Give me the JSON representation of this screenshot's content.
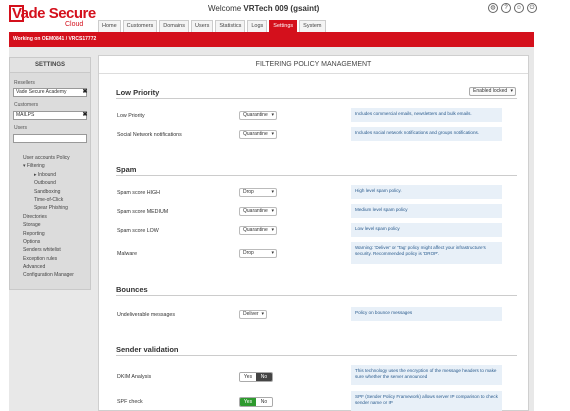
{
  "brand": {
    "name": "Vade Secure",
    "sub": "Cloud"
  },
  "header": {
    "welcome_prefix": "Welcome ",
    "welcome_user": "VRTech 009 (gsaint)",
    "tabs": [
      {
        "label": "Home"
      },
      {
        "label": "Customers"
      },
      {
        "label": "Domains"
      },
      {
        "label": "Users"
      },
      {
        "label": "Statistics"
      },
      {
        "label": "Logs"
      },
      {
        "label": "Settings",
        "active": true
      },
      {
        "label": "System"
      }
    ]
  },
  "context_bar": "Working on OEM0841 / VRCS17772",
  "sidebar": {
    "title": "SETTINGS",
    "reseller_label": "Resellers",
    "reseller_value": "Vade Secure Academy",
    "customer_label": "Customers",
    "customer_value": "MAILPS",
    "users_label": "Users",
    "users_value": "",
    "menu": [
      {
        "label": "User accounts Policy",
        "level": 1
      },
      {
        "label": "▾ Filtering",
        "level": 1
      },
      {
        "label": "▸ Inbound",
        "level": 2
      },
      {
        "label": "Outbound",
        "level": 2
      },
      {
        "label": "Sandboxing",
        "level": 2
      },
      {
        "label": "Time-of-Click",
        "level": 2
      },
      {
        "label": "Spear Phishing",
        "level": 2
      },
      {
        "label": "Directories",
        "level": 1
      },
      {
        "label": "Storage",
        "level": 1
      },
      {
        "label": "Reporting",
        "level": 1
      },
      {
        "label": "Options",
        "level": 1
      },
      {
        "label": "Senders whitelist",
        "level": 1
      },
      {
        "label": "Exception rules",
        "level": 1
      },
      {
        "label": "Advanced",
        "level": 1
      },
      {
        "label": "Configuration Manager",
        "level": 1
      }
    ]
  },
  "main": {
    "title": "FILTERING POLICY MANAGEMENT",
    "mode_select": "Enabled locked",
    "sections": {
      "low_priority": {
        "title": "Low Priority",
        "rows": [
          {
            "label": "Low Priority",
            "value": "Quarantine",
            "desc": "Includes commercial emails, newsletters and bulk emails."
          },
          {
            "label": "Social Network notifications",
            "value": "Quarantine",
            "desc": "Includes social network notifications and groups notifications."
          }
        ]
      },
      "spam": {
        "title": "Spam",
        "rows": [
          {
            "label": "Spam score HIGH",
            "value": "Drop",
            "desc": "High level spam policy."
          },
          {
            "label": "Spam score MEDIUM",
            "value": "Quarantine",
            "desc": "Medium level spam policy"
          },
          {
            "label": "Spam score LOW",
            "value": "Quarantine",
            "desc": "Low level spam policy"
          },
          {
            "label": "Malware",
            "value": "Drop",
            "desc": "Warning: 'Deliver' or 'Tag' policy might affect your infrastructure's security. Recommended policy is 'DROP'."
          }
        ]
      },
      "bounces": {
        "title": "Bounces",
        "rows": [
          {
            "label": "Undeliverable messages",
            "value": "Deliver",
            "desc": "Policy on bounce messages"
          }
        ]
      },
      "sender_validation": {
        "title": "Sender validation",
        "rows": [
          {
            "label": "DKIM Analysis",
            "yes": "Yes",
            "no": "No",
            "selected": "No",
            "desc": "This technology uses the encryption of the message headers to make sure whether the server announced"
          },
          {
            "label": "SPF check",
            "yes": "Yes",
            "no": "No",
            "selected": "Yes",
            "desc": "SPF (Sender Policy Framework) allows server IP comparison to check sender name or IP"
          }
        ]
      }
    }
  },
  "colors": {
    "brand_red": "#d4101c",
    "desc_bg": "#e8f0f8",
    "toggle_on_green": "#2e9a2e"
  }
}
